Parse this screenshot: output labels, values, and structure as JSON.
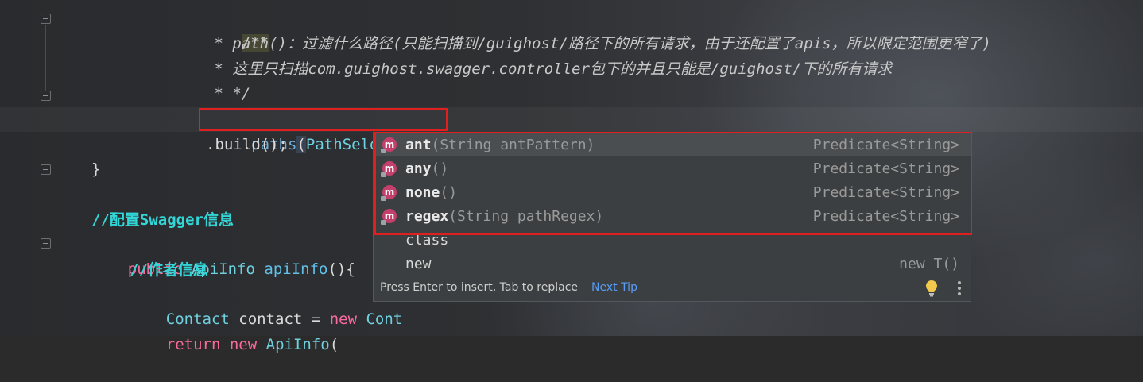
{
  "editor": {
    "lines": {
      "doc_open": "/**",
      "doc_path": " * path()：过滤什么路径(只能扫描到/guighost/路径下的所有请求，由于还配置了apis，所以限定范围更窄了)",
      "doc_scan": " * 这里只扫描com.guighost.swagger.controller包下的并且只能是/guighost/下的所有请求",
      "doc_close": " * */",
      "paths_dot": ".",
      "paths_method": "paths",
      "paths_paren_open": "(",
      "paths_class": "PathSelectors",
      "paths_tail": ".)",
      "build": ".build();",
      "brace_close": "}",
      "comment_swagger": "//配置Swagger信息",
      "kw_public": "public",
      "type_apiinfo": "ApiInfo",
      "fn_apiinfo": "apiInfo",
      "fn_apiinfo_tail": "(){",
      "comment_author": "//作者信息",
      "type_contact": "Contact",
      "var_contact": " contact = ",
      "kw_new": "new",
      "type_cont_partial": "Cont",
      "kw_return": "return",
      "kw_new2": "new",
      "type_apiinfo2": "ApiInfo",
      "paren_open": "("
    }
  },
  "completion": {
    "items": [
      {
        "name": "ant",
        "params": "(String antPattern)",
        "type": "Predicate<String>",
        "icon": "method-icon",
        "icon_letter": "m"
      },
      {
        "name": "any",
        "params": "()",
        "type": "Predicate<String>",
        "icon": "method-icon",
        "icon_letter": "m"
      },
      {
        "name": "none",
        "params": "()",
        "type": "Predicate<String>",
        "icon": "method-icon",
        "icon_letter": "m"
      },
      {
        "name": "regex",
        "params": "(String pathRegex)",
        "type": "Predicate<String>",
        "icon": "method-icon",
        "icon_letter": "m"
      }
    ],
    "extra": [
      {
        "name": "class",
        "type": ""
      },
      {
        "name": "new",
        "type": "new T()"
      }
    ],
    "footer": {
      "hint": "Press Enter to insert, Tab to replace",
      "next_tip": "Next Tip"
    }
  },
  "colors": {
    "highlight_box": "#e02020",
    "method_icon": "#c2406b",
    "link": "#589df6"
  }
}
